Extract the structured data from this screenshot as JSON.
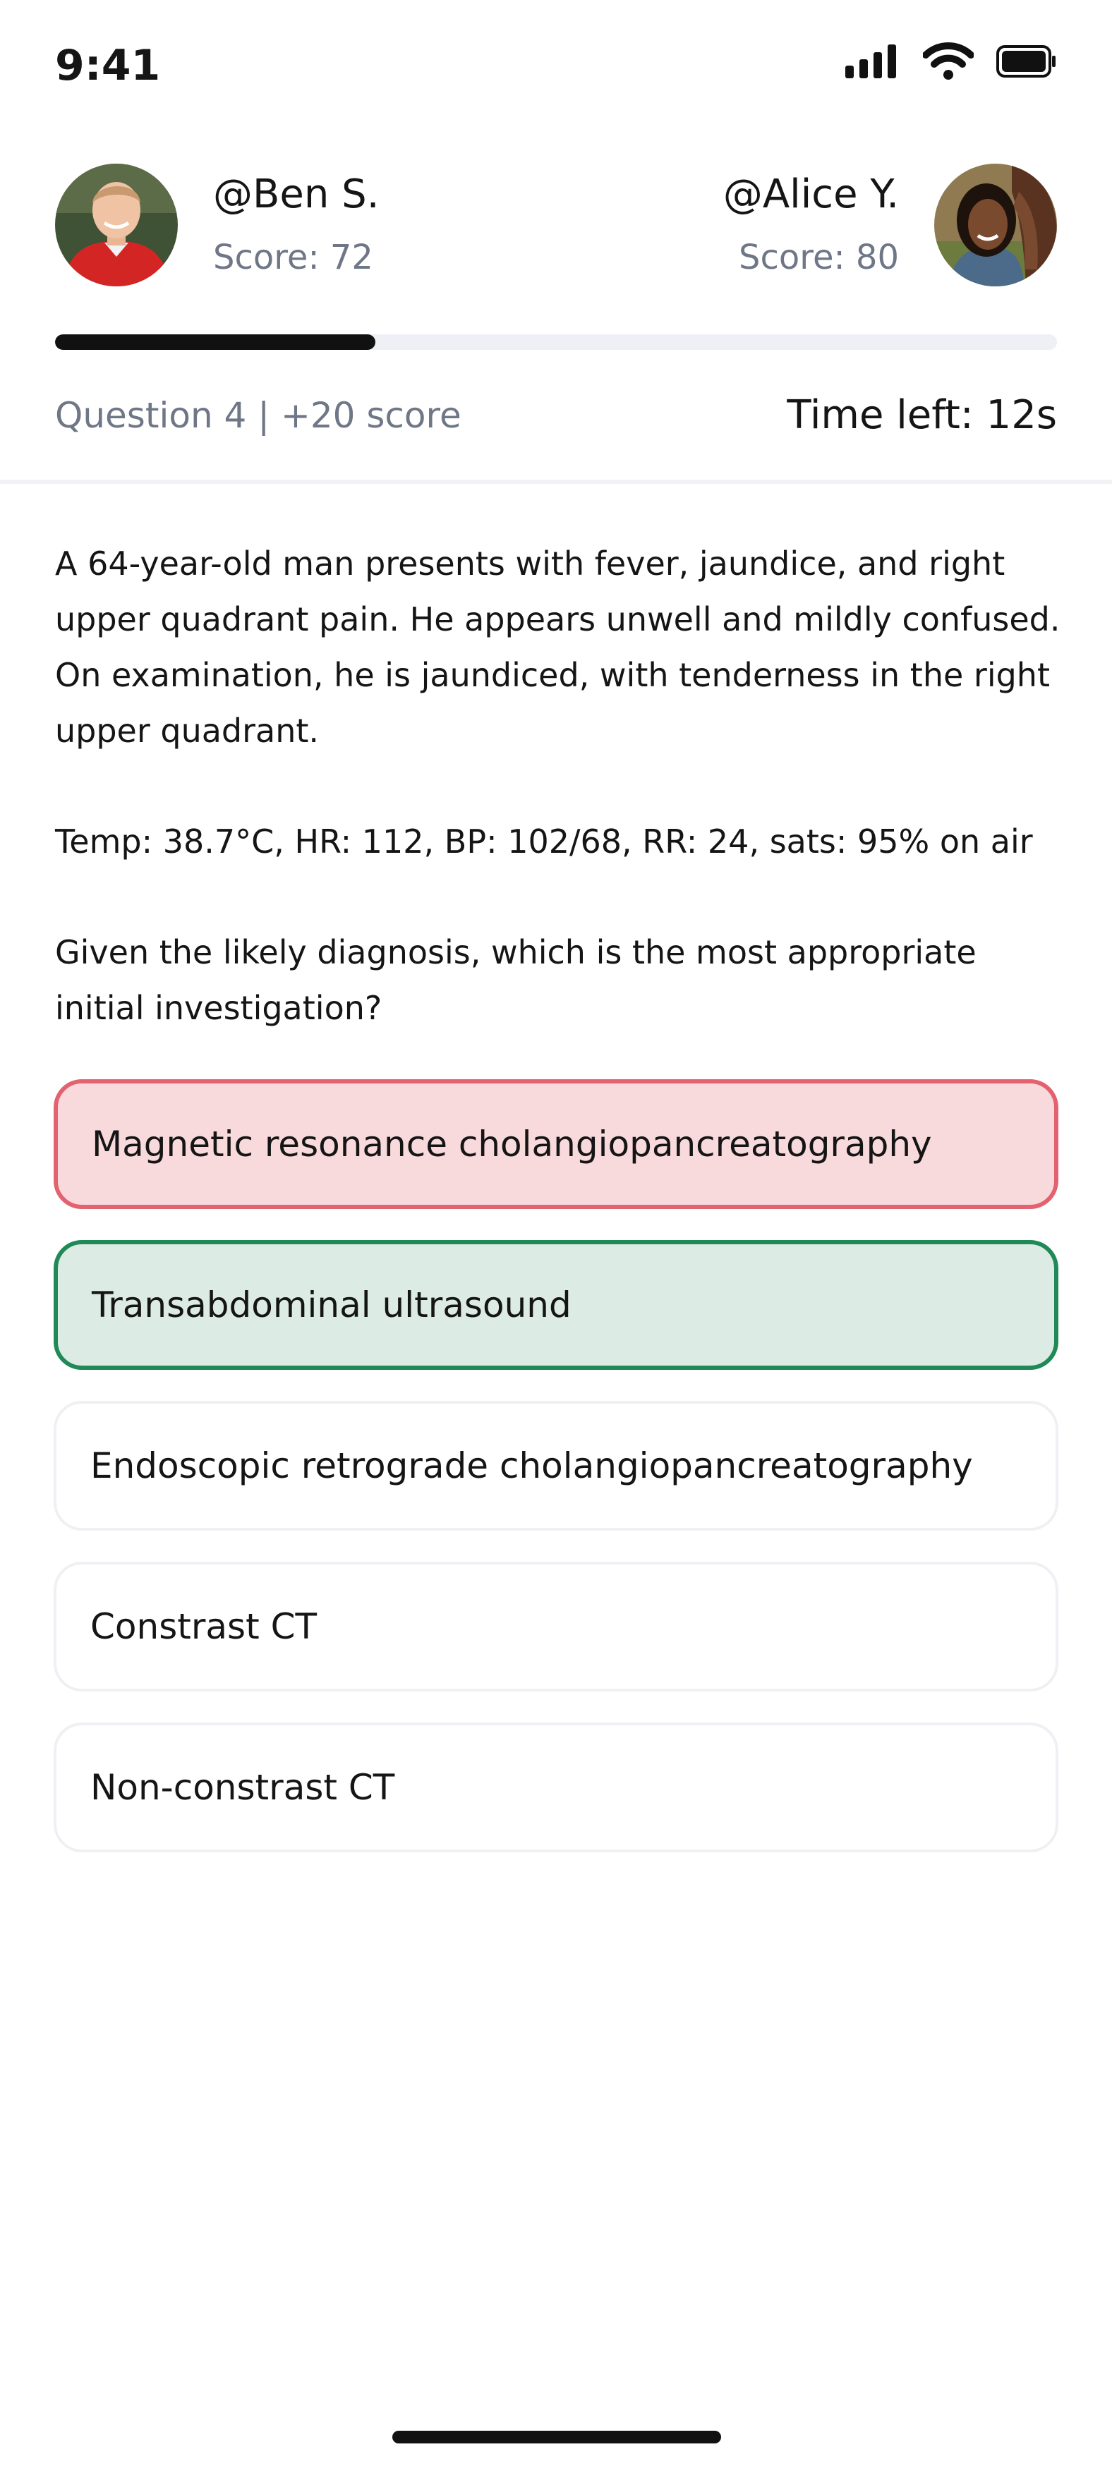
{
  "status_bar": {
    "time": "9:41"
  },
  "player_left": {
    "handle": "@Ben S.",
    "score": "Score: 72"
  },
  "player_right": {
    "handle": "@Alice Y.",
    "score": "Score: 80"
  },
  "progress": {
    "fraction": 0.32
  },
  "question_meta": {
    "label": "Question 4 | +20 score",
    "time_left": "Time left: 12s"
  },
  "question": {
    "paragraph1": "A 64-year-old man presents with fever, jaundice, and right upper quadrant pain. He appears unwell and mildly confused. On examination, he is jaundiced, with tenderness in the right upper quadrant.",
    "paragraph2": "Temp: 38.7°C, HR: 112, BP: 102/68, RR: 24, sats: 95% on air",
    "paragraph3": "Given the likely diagnosis, which is the most appropriate initial investigation?"
  },
  "options": [
    {
      "label": "Magnetic resonance cholangiopancreatography",
      "state": "wrong"
    },
    {
      "label": "Transabdominal ultrasound",
      "state": "correct"
    },
    {
      "label": "Endoscopic retrograde cholangiopancreatography",
      "state": "neutral"
    },
    {
      "label": "Constrast CT",
      "state": "neutral"
    },
    {
      "label": "Non-constrast CT",
      "state": "neutral"
    }
  ],
  "colors": {
    "wrong_bg": "#f8d9dc",
    "wrong_border": "#e2636f",
    "correct_bg": "#dcebe3",
    "correct_border": "#1f8a57"
  }
}
